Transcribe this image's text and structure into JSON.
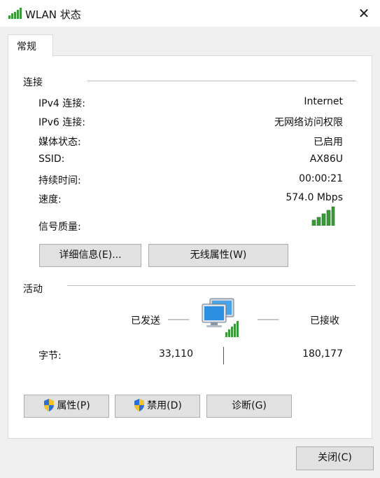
{
  "window": {
    "title": "WLAN 状态",
    "close_glyph": "✕"
  },
  "tabs": [
    {
      "label": "常规"
    }
  ],
  "connection": {
    "heading": "连接",
    "rows": [
      {
        "label": "IPv4 连接:",
        "value": "Internet"
      },
      {
        "label": "IPv6 连接:",
        "value": "无网络访问权限"
      },
      {
        "label": "媒体状态:",
        "value": "已启用"
      },
      {
        "label": "SSID:",
        "value": "AX86U"
      },
      {
        "label": "持续时间:",
        "value": "00:00:21"
      },
      {
        "label": "速度:",
        "value": "574.0 Mbps"
      }
    ],
    "signal_label": "信号质量:",
    "signal_bars_lit": 5,
    "signal_bars_total": 5,
    "details_button": "详细信息(E)...",
    "wireless_props_button": "无线属性(W)"
  },
  "activity": {
    "heading": "活动",
    "sent_label": "已发送",
    "received_label": "已接收",
    "bytes_label": "字节:",
    "bytes_sent": "33,110",
    "bytes_received": "180,177"
  },
  "actions": {
    "properties_button": "属性(P)",
    "disable_button": "禁用(D)",
    "diagnose_button": "诊断(G)"
  },
  "footer": {
    "close_button": "关闭(C)"
  },
  "colors": {
    "signal_green": "#3a9a3a",
    "shield_blue": "#2f6fd0",
    "shield_yellow": "#f2c12e",
    "button_face": "#e1e1e1"
  }
}
